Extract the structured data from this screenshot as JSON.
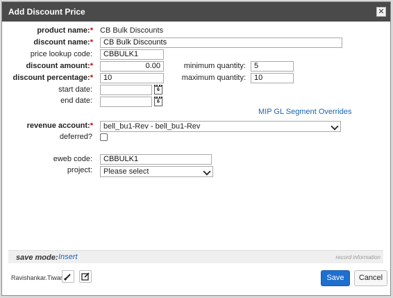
{
  "dialog": {
    "title": "Add Discount Price",
    "close_glyph": "✕"
  },
  "labels": {
    "product_name": "product name:",
    "discount_name": "discount name:",
    "price_lookup_code": "price lookup code:",
    "discount_amount": "discount amount:",
    "discount_percentage": "discount percentage:",
    "start_date": "start date:",
    "end_date": "end date:",
    "minimum_quantity": "minimum quantity:",
    "maximum_quantity": "maximum quantity:",
    "revenue_account": "revenue account:",
    "deferred": "deferred?",
    "eweb_code": "eweb code:",
    "project": "project:",
    "required_marker": "*"
  },
  "values": {
    "product_name": "CB Bulk Discounts",
    "discount_name": "CB Bulk Discounts",
    "price_lookup_code": "CBBULK1",
    "discount_amount": "0.00",
    "discount_percentage": "10",
    "start_date": "",
    "end_date": "",
    "minimum_quantity": "5",
    "maximum_quantity": "10",
    "revenue_account": "bell_bu1-Rev - bell_bu1-Rev",
    "deferred": false,
    "eweb_code": "CBBULK1",
    "project": "Please select"
  },
  "links": {
    "mip_gl": "MIP GL Segment Overrides"
  },
  "calendar_icon_text": "6",
  "statusbar": {
    "save_mode_label": "save mode:",
    "save_mode_value": "Insert",
    "record_info": "record information"
  },
  "footer": {
    "user": "Ravishankar.Tiwari",
    "save_label": "Save",
    "cancel_label": "Cancel"
  },
  "colors": {
    "titlebar": "#4a4a4a",
    "primary_button": "#1f6fcf",
    "link": "#1a64b3",
    "required": "#cc0000"
  }
}
